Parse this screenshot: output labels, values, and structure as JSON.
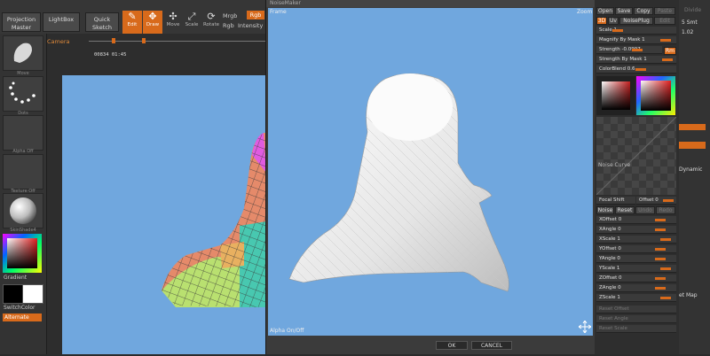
{
  "toolbar": {
    "projection_master": "Projection Master",
    "lightbox": "LightBox",
    "quick_sketch": "Quick Sketch",
    "edit": "Edit",
    "draw": "Draw",
    "move": "Move",
    "scale": "Scale",
    "rotate": "Rotate",
    "mrgb": "Mrgb",
    "rgb": "Rgb",
    "rgb2": "Rgb",
    "intensity": "Intensity",
    "camera": "Camera",
    "timeline_value": "00834 01:45"
  },
  "left_shelf": {
    "slot1_label": "Move",
    "slot2_label": "Dots",
    "slot3_label": "Alpha Off",
    "slot4_label": "Texture Off",
    "slot5_label": "SkinShade4",
    "gradient": "Gradient",
    "switch_color": "SwitchColor",
    "alternate": "Alternate"
  },
  "modal": {
    "title": "NoiseMaker",
    "frame": "Frame",
    "zoom": "Zoom",
    "alpha_toggle": "Alpha On/Off",
    "ok": "OK",
    "cancel": "CANCEL"
  },
  "right_panel": {
    "open": "Open",
    "save": "Save",
    "copy": "Copy",
    "paste": "Paste",
    "mode_3d": "3D",
    "uv": "Uv",
    "noise_plug": "NoisePlug",
    "edit": "Edit",
    "scale": "Scale 1",
    "magnify_by_mask": "Magnify By Mask 1",
    "strength": "Strength -0.0997",
    "strength_by_mask": "Strength By Mask 1",
    "color_blend": "ColorBlend 0.6",
    "noise_curve": "Noise Curve",
    "focal_shift": "Focal Shift",
    "offset": "Offset 0",
    "noise": "Noise",
    "reset": "Reset",
    "undo": "Undo",
    "redo": "Redo",
    "xoffset": "XOffset 0",
    "xangle": "XAngle 0",
    "xscale": "XScale 1",
    "yoffset": "YOffset 0",
    "yangle": "YAngle 0",
    "yscale": "YScale 1",
    "zoffset": "ZOffset 0",
    "zangle": "ZAngle 0",
    "zscale": "ZScale 1",
    "reset_offset": "Reset Offset",
    "reset_angle": "Reset Angle",
    "reset_scale": "Reset Scale",
    "rm": "Rm"
  },
  "far_right": {
    "top_value": "1.02",
    "smt": "5 Smt",
    "divide_label": "Divide",
    "dynamic": "Dynamic",
    "ret_map": "et Map"
  },
  "colors": {
    "accent": "#d86a1b",
    "canvas_blue": "#70a7de",
    "panel_dark": "#2e2e2e"
  }
}
